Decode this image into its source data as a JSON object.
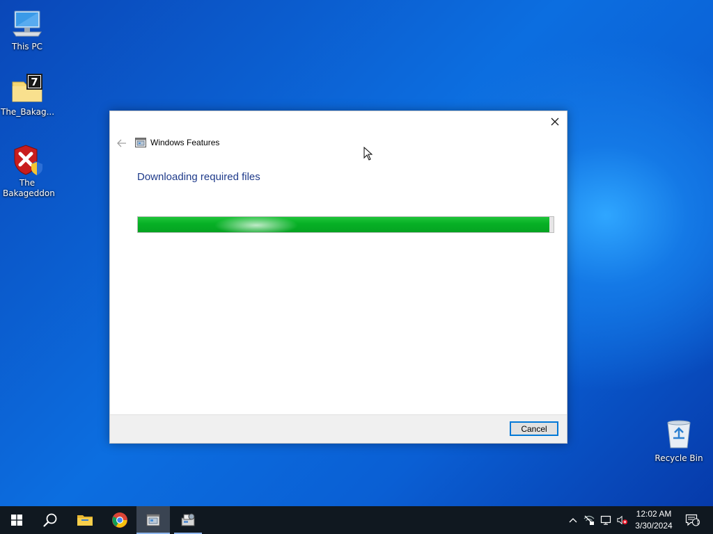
{
  "desktop": {
    "icons": [
      {
        "label": "This PC",
        "icon": "computer-icon"
      },
      {
        "label": "The_Bakag...",
        "icon": "archive-icon"
      },
      {
        "label": "The Bakageddon",
        "icon": "shield-error-icon"
      },
      {
        "label": "Recycle Bin",
        "icon": "recycle-bin-icon"
      }
    ]
  },
  "dialog": {
    "title": "Windows Features",
    "heading": "Downloading required files",
    "progress_fraction": 0.99,
    "cancel_label": "Cancel",
    "close_icon": "close-icon",
    "back_icon": "back-arrow-icon",
    "app_icon": "windows-features-icon"
  },
  "taskbar": {
    "buttons": [
      {
        "name": "start",
        "icon": "windows-logo-icon"
      },
      {
        "name": "search",
        "icon": "search-icon"
      },
      {
        "name": "file-explorer",
        "icon": "folder-icon"
      },
      {
        "name": "chrome",
        "icon": "chrome-icon"
      },
      {
        "name": "windows-features",
        "icon": "windows-features-icon"
      },
      {
        "name": "setup",
        "icon": "setup-icon"
      }
    ],
    "tray": {
      "icons": [
        "chevron-up-icon",
        "network-off-icon",
        "display-icon",
        "volume-muted-icon"
      ],
      "time": "12:02 AM",
      "date": "3/30/2024",
      "notification_count": "1"
    }
  },
  "colors": {
    "progress_green": "#06b025",
    "heading_blue": "#1e3a8a",
    "taskbar": "#101820",
    "accent": "#0078d7"
  }
}
